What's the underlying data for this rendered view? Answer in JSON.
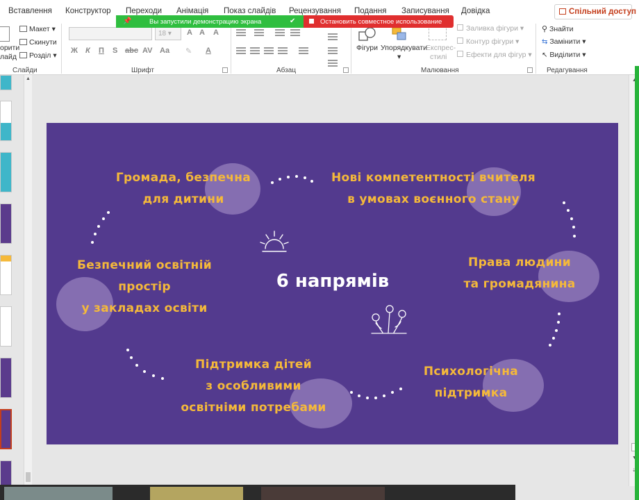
{
  "menu": {
    "tabs": [
      "Вставлення",
      "Конструктор",
      "Переходи",
      "Анімація",
      "Показ слайдів",
      "Рецензування",
      "Подання",
      "Записування",
      "Довідка"
    ],
    "share_label": "Спільний доступ"
  },
  "banner": {
    "sharing_text": "Вы запустили демонстрацию экрана",
    "stop_text": "Остановить совместное использование"
  },
  "ribbon": {
    "slides": {
      "layout": "Макет",
      "reset": "Скинути",
      "section": "Розділ",
      "partial_1": "орити",
      "partial_2": "лайд",
      "label": "Слайди"
    },
    "font": {
      "size": "18",
      "label": "Шрифт"
    },
    "paragraph": {
      "label": "Абзац"
    },
    "drawing": {
      "shapes": "Фігури",
      "arrange": "Упорядкувати",
      "express_1": "Експрес-",
      "express_2": "стилі",
      "fill": "Заливка фігури",
      "outline": "Контур фігури",
      "effects": "Ефекти для фігур",
      "label": "Малювання"
    },
    "editing": {
      "find": "Знайти",
      "replace": "Замінити",
      "select": "Виділити",
      "label": "Редагування"
    }
  },
  "slide": {
    "title": "6 напрямів",
    "items": [
      {
        "line1": "Громада, безпечна",
        "line2": "для дитини"
      },
      {
        "line1": "Нові компетентності вчителя",
        "line2": "в умовах воєнного стану"
      },
      {
        "line1": "Безпечний освітній",
        "line2": "простір",
        "line3": "у закладах освіти"
      },
      {
        "line1": "Права людини",
        "line2": "та громадянина"
      },
      {
        "line1": "Підтримка дітей",
        "line2": "з особливими",
        "line3": "освітніми потребами"
      },
      {
        "line1": "Психологічна",
        "line2": "підтримка"
      }
    ]
  },
  "colors": {
    "slide_bg": "#533a8e",
    "slide_text": "#f5b93a",
    "blob": "#9f8bc4",
    "accent": "#c43e1c",
    "banner_green": "#2fbe3f",
    "banner_red": "#e02f2f"
  }
}
